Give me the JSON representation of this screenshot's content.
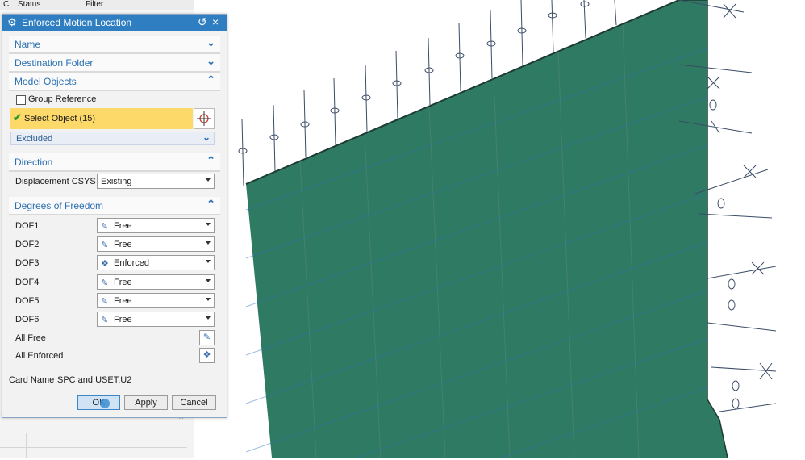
{
  "background_table": {
    "headers": [
      "C.",
      "Status",
      "Filter"
    ]
  },
  "dialog": {
    "title": "Enforced Motion Location",
    "sections": {
      "name": "Name",
      "destination_folder": "Destination Folder",
      "model_objects": "Model Objects",
      "direction": "Direction",
      "dof": "Degrees of Freedom"
    },
    "group_reference_label": "Group Reference",
    "select_object_label": "Select Object (15)",
    "excluded_label": "Excluded",
    "displacement_csys_label": "Displacement CSYS",
    "displacement_csys_value": "Existing",
    "dof_rows": [
      {
        "label": "DOF1",
        "value": "Free",
        "icon": "free-icon"
      },
      {
        "label": "DOF2",
        "value": "Free",
        "icon": "free-icon"
      },
      {
        "label": "DOF3",
        "value": "Enforced",
        "icon": "enforced-icon"
      },
      {
        "label": "DOF4",
        "value": "Free",
        "icon": "free-icon"
      },
      {
        "label": "DOF5",
        "value": "Free",
        "icon": "free-icon"
      },
      {
        "label": "DOF6",
        "value": "Free",
        "icon": "free-icon"
      }
    ],
    "all_free_label": "All Free",
    "all_enforced_label": "All Enforced",
    "card_name_label": "Card Name",
    "card_name_value": "SPC and USET,U2",
    "ok_label": "OK",
    "apply_label": "Apply",
    "cancel_label": "Cancel"
  },
  "colors": {
    "title_bar": "#2f7ec1",
    "section_header_text": "#2b70b2",
    "selection_highlight": "#fdd96a",
    "surface": "#2f7a62",
    "mesh_lines": "#2a6fc0"
  }
}
